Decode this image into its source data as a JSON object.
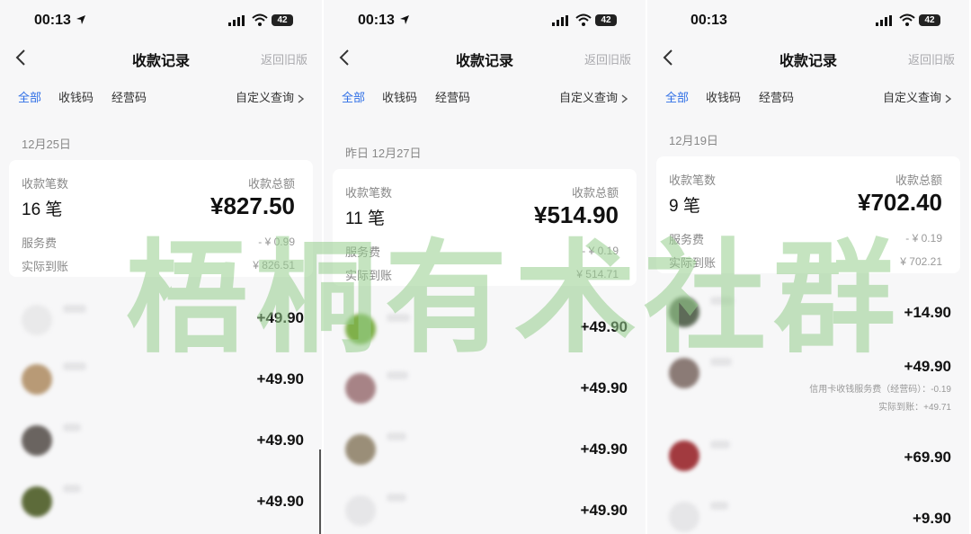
{
  "screens": [
    {
      "status": {
        "time": "00:13",
        "battery": "42"
      },
      "nav": {
        "title": "收款记录",
        "old_version": "返回旧版"
      },
      "tabs": [
        "全部",
        "收钱码",
        "经营码"
      ],
      "custom_query": "自定义查询",
      "date": "12月25日",
      "summary": {
        "count_label": "收款笔数",
        "count": "16 笔",
        "total_label": "收款总额",
        "total": "¥827.50",
        "fee_label": "服务费",
        "fee": "- ¥ 0.99",
        "net_label": "实际到账",
        "net": "¥ 826.51"
      },
      "items": [
        {
          "amount": "+49.90"
        },
        {
          "amount": "+49.90"
        },
        {
          "amount": "+49.90"
        },
        {
          "amount": "+49.90"
        }
      ]
    },
    {
      "status": {
        "time": "00:13",
        "battery": "42"
      },
      "nav": {
        "title": "收款记录",
        "old_version": "返回旧版"
      },
      "tabs": [
        "全部",
        "收钱码",
        "经营码"
      ],
      "custom_query": "自定义查询",
      "date": "昨日 12月27日",
      "summary": {
        "count_label": "收款笔数",
        "count": "11 笔",
        "total_label": "收款总额",
        "total": "¥514.90",
        "fee_label": "服务费",
        "fee": "- ¥ 0.19",
        "net_label": "实际到账",
        "net": "¥ 514.71"
      },
      "items": [
        {
          "amount": "+49.90"
        },
        {
          "amount": "+49.90"
        },
        {
          "amount": "+49.90"
        },
        {
          "amount": "+49.90"
        }
      ]
    },
    {
      "status": {
        "time": "00:13",
        "battery": "42"
      },
      "nav": {
        "title": "收款记录",
        "old_version": "返回旧版"
      },
      "tabs": [
        "全部",
        "收钱码",
        "经营码"
      ],
      "custom_query": "自定义查询",
      "date": "12月19日",
      "summary": {
        "count_label": "收款笔数",
        "count": "9 笔",
        "total_label": "收款总额",
        "total": "¥702.40",
        "fee_label": "服务费",
        "fee": "- ¥ 0.19",
        "net_label": "实际到账",
        "net": "¥ 702.21"
      },
      "items": [
        {
          "amount": "+14.90"
        },
        {
          "amount": "+49.90",
          "note1": "信用卡收钱服务费（经营码）：-0.19",
          "note2": "实际到账：+49.71"
        },
        {
          "amount": "+69.90"
        },
        {
          "amount": "+9.90"
        }
      ]
    }
  ],
  "watermark": "梧桐有术社群",
  "colors": {
    "accent": "#2f6fe6",
    "watermark": "#96cd8c",
    "background": "#f7f7f8"
  }
}
